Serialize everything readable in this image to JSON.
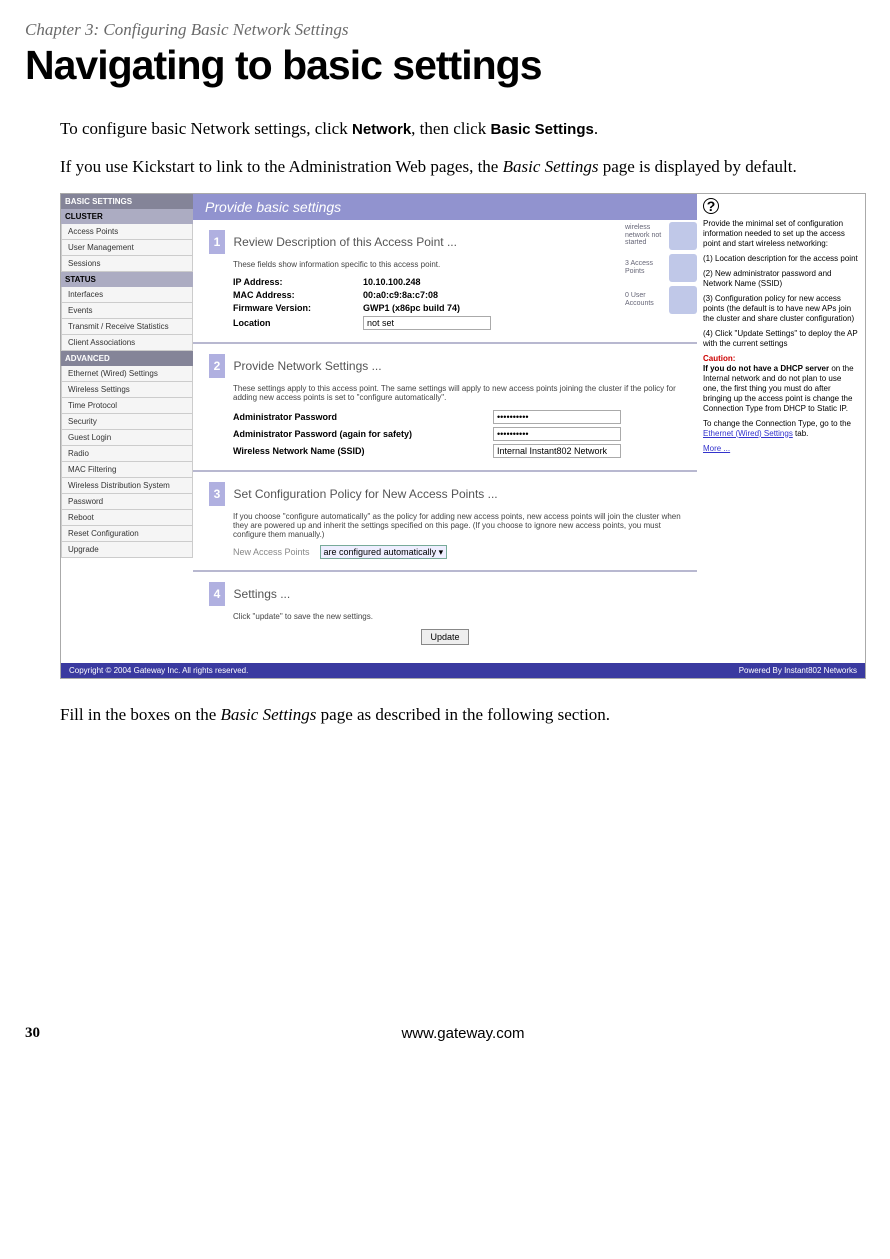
{
  "chapter": "Chapter 3: Configuring Basic Network Settings",
  "title": "Navigating to basic settings",
  "intro1_a": "To configure basic Network settings, click ",
  "intro1_b": "Network",
  "intro1_c": ", then click ",
  "intro1_d": "Basic Settings",
  "intro1_e": ".",
  "intro2_a": "If you use Kickstart to link to the Administration Web pages, the ",
  "intro2_b": "Basic Settings",
  "intro2_c": " page is displayed by default.",
  "after_a": "Fill in the boxes on the ",
  "after_b": "Basic Settings",
  "after_c": " page as described in the following section.",
  "page_num": "30",
  "page_url": "www.gateway.com",
  "ui": {
    "banner": "Provide basic settings",
    "sidebar": {
      "basic": "BASIC SETTINGS",
      "cluster": "CLUSTER",
      "cluster_items": [
        "Access Points",
        "User Management",
        "Sessions"
      ],
      "status": "STATUS",
      "status_items": [
        "Interfaces",
        "Events",
        "Transmit / Receive Statistics",
        "Client Associations"
      ],
      "advanced": "ADVANCED",
      "advanced_items": [
        "Ethernet (Wired) Settings",
        "Wireless Settings",
        "Time Protocol",
        "Security",
        "Guest Login",
        "Radio",
        "MAC Filtering",
        "Wireless Distribution System",
        "Password",
        "Reboot",
        "Reset Configuration",
        "Upgrade"
      ]
    },
    "cards": {
      "c1": "wireless network not started",
      "c2": "3 Access Points",
      "c3": "0 User Accounts"
    },
    "sec1": {
      "title": "Review Description of this Access Point ...",
      "note": "These fields show information specific to this access point.",
      "ip_l": "IP Address:",
      "ip_v": "10.10.100.248",
      "mac_l": "MAC Address:",
      "mac_v": "00:a0:c9:8a:c7:08",
      "fw_l": "Firmware Version:",
      "fw_v": "GWP1 (x86pc build 74)",
      "loc_l": "Location",
      "loc_v": "not set"
    },
    "sec2": {
      "title": "Provide Network Settings ...",
      "note": "These settings apply to this access point. The same settings will apply to new access points joining the cluster if the policy for adding new access points is set to \"configure automatically\".",
      "pw1_l": "Administrator Password",
      "pw2_l": "Administrator Password (again for safety)",
      "pw_v": "••••••••••",
      "ssid_l": "Wireless Network Name (SSID)",
      "ssid_v": "Internal Instant802 Network"
    },
    "sec3": {
      "title": "Set Configuration Policy for New Access Points ...",
      "note": "If you choose \"configure automatically\" as the policy for adding new access points, new access points will join the cluster when they are powered up and inherit the settings specified on this page. (If you choose to ignore new access points, you must configure them manually.)",
      "nap_l": "New Access Points",
      "nap_v": "are configured automatically"
    },
    "sec4": {
      "title": "Settings ...",
      "note": "Click \"update\" to save the new settings.",
      "btn": "Update"
    },
    "footer_l": "Copyright © 2004 Gateway Inc. All rights reserved.",
    "footer_r": "Powered By Instant802 Networks",
    "help": {
      "p1": "Provide the minimal set of configuration information needed to set up the access point and start wireless networking:",
      "p2": "(1) Location description for the access point",
      "p3": "(2) New administrator password and Network Name (SSID)",
      "p4": "(3) Configuration policy for new access points (the default is to have new APs join the cluster and share cluster configuration)",
      "p5": "(4) Click \"Update Settings\" to deploy the AP with the current settings",
      "caution": "Caution:",
      "p6a": "If you do not have a DHCP server",
      "p6b": " on the Internal network and do not plan to use one, the first thing you must do after bringing up the access point is change the Connection Type from DHCP to Static IP.",
      "p7": "To change the Connection Type, go to the ",
      "link1": "Ethernet (Wired) Settings",
      "p7b": " tab.",
      "more": "More ..."
    }
  }
}
